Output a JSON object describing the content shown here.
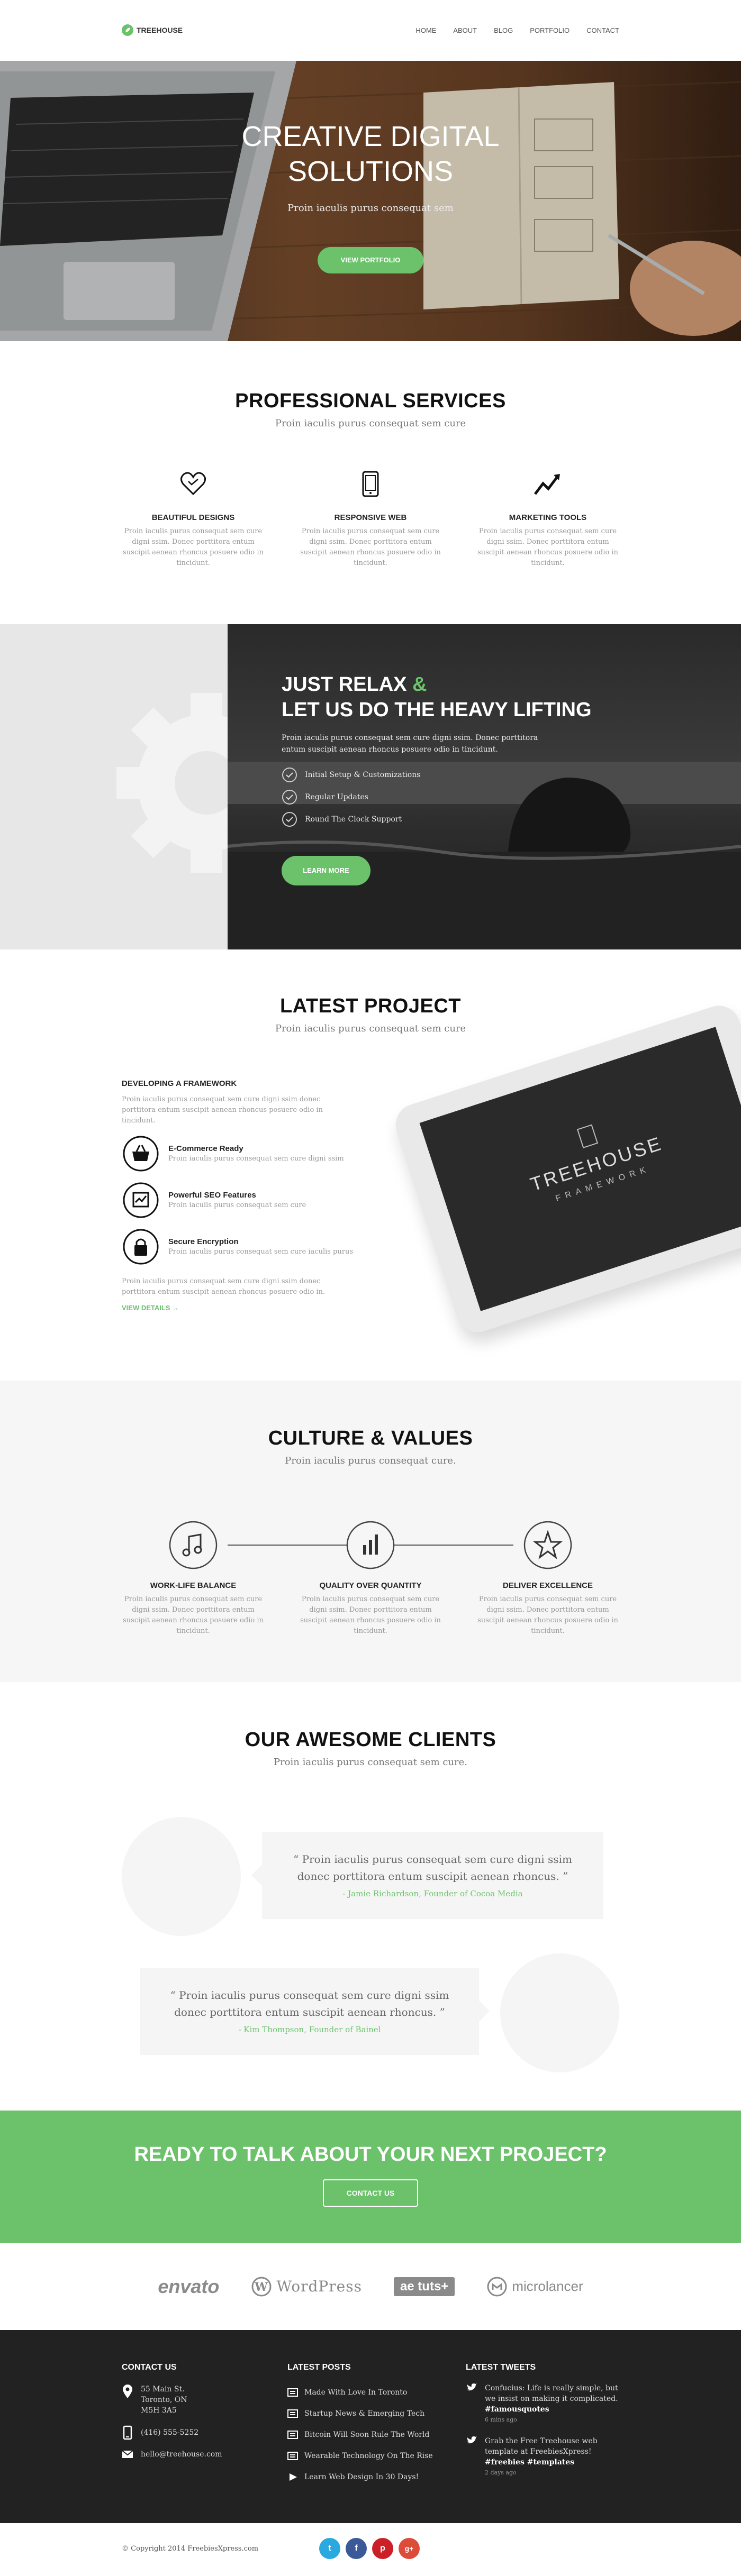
{
  "nav": {
    "brand": "TREEHOUSE",
    "items": [
      "HOME",
      "ABOUT",
      "BLOG",
      "PORTFOLIO",
      "CONTACT"
    ]
  },
  "hero": {
    "title_line1": "CREATIVE DIGITAL",
    "title_line2": "SOLUTIONS",
    "subtitle": "Proin iaculis purus consequat sem",
    "button": "VIEW PORTFOLIO"
  },
  "services": {
    "title": "PROFESSIONAL SERVICES",
    "subtitle": "Proin iaculis purus consequat sem cure",
    "items": [
      {
        "icon": "heart-icon",
        "title": "BEAUTIFUL DESIGNS",
        "text": "Proin iaculis purus consequat sem cure digni ssim. Donec porttitora entum suscipit aenean rhoncus posuere odio in tincidunt."
      },
      {
        "icon": "tablet-icon",
        "title": "RESPONSIVE WEB",
        "text": "Proin iaculis purus consequat sem cure digni ssim. Donec porttitora entum suscipit aenean rhoncus posuere odio in tincidunt."
      },
      {
        "icon": "chart-icon",
        "title": "MARKETING TOOLS",
        "text": "Proin iaculis purus consequat sem cure digni ssim. Donec porttitora entum suscipit aenean rhoncus posuere odio in tincidunt."
      }
    ]
  },
  "relax": {
    "title_a": "JUST RELAX ",
    "title_amp": "&",
    "title_b": "LET US DO THE HEAVY LIFTING",
    "text": "Proin iaculis purus consequat sem cure  digni ssim. Donec porttitora entum suscipit  aenean rhoncus posuere odio in tincidunt.",
    "list": [
      "Initial Setup & Customizations",
      "Regular Updates",
      "Round The Clock Support"
    ],
    "button": "LEARN MORE"
  },
  "project": {
    "title": "LATEST PROJECT",
    "subtitle": "Proin iaculis purus consequat sem cure",
    "heading": "DEVELOPING A FRAMEWORK",
    "intro": "Proin iaculis purus consequat sem cure  digni ssim donec porttitora entum suscipit  aenean rhoncus posuere odio in tincidunt.",
    "features": [
      {
        "icon": "basket-icon",
        "title": "E-Commerce Ready",
        "text": "Proin iaculis purus consequat sem cure  digni ssim"
      },
      {
        "icon": "seo-chart-icon",
        "title": "Powerful SEO Features",
        "text": "Proin iaculis purus consequat sem cure"
      },
      {
        "icon": "lock-icon",
        "title": "Secure Encryption",
        "text": "Proin iaculis purus consequat sem cure iaculis purus"
      }
    ],
    "outro": "Proin iaculis purus consequat sem cure  digni ssim donec porttitora entum suscipit  aenean rhoncus posuere odio in.",
    "link": "VIEW DETAILS →",
    "tablet_brand": "TREEHOUSE",
    "tablet_sub": "FRAMEWORK"
  },
  "culture": {
    "title": "CULTURE & VALUES",
    "subtitle": "Proin iaculis purus consequat cure.",
    "items": [
      {
        "icon": "music-icon",
        "title": "WORK-LIFE BALANCE",
        "text": "Proin iaculis purus consequat sem cure digni ssim. Donec porttitora entum suscipit aenean rhoncus posuere odio in tincidunt."
      },
      {
        "icon": "bars-icon",
        "title": "QUALITY OVER QUANTITY",
        "text": "Proin iaculis purus consequat sem cure digni ssim. Donec porttitora entum suscipit aenean rhoncus posuere odio in tincidunt."
      },
      {
        "icon": "star-icon",
        "title": "DELIVER EXCELLENCE",
        "text": "Proin iaculis purus consequat sem cure digni ssim. Donec porttitora entum suscipit aenean rhoncus posuere odio in tincidunt."
      }
    ]
  },
  "clients": {
    "title": "OUR AWESOME CLIENTS",
    "subtitle": "Proin iaculis purus consequat sem cure.",
    "testimonials": [
      {
        "quote": "“ Proin iaculis purus consequat sem cure  digni ssim donec porttitora entum suscipit aenean rhoncus. ”",
        "author": "- Jamie Richardson, Founder of Cocoa Media"
      },
      {
        "quote": "“ Proin iaculis purus consequat sem cure  digni ssim donec porttitora entum suscipit aenean rhoncus. ”",
        "author": "- Kim Thompson, Founder of Bainel"
      }
    ]
  },
  "cta": {
    "title": "READY TO TALK ABOUT YOUR NEXT PROJECT?",
    "button": "CONTACT US"
  },
  "logos": [
    "envato",
    "WordPress",
    "ae tuts+",
    "microlancer"
  ],
  "footer": {
    "contact_title": "CONTACT US",
    "address": [
      "55 Main St.",
      "Toronto, ON",
      "M5H 3A5"
    ],
    "phone": "(416) 555-5252",
    "email": "hello@treehouse.com",
    "posts_title": "LATEST POSTS",
    "posts": [
      "Made With Love In Toronto",
      "Startup News & Emerging Tech",
      "Bitcoin Will Soon Rule The World",
      "Wearable Technology On The Rise",
      "Learn Web Design In 30 Days!"
    ],
    "tweets_title": "LATEST TWEETS",
    "tweets": [
      {
        "text": "Confucius: Life is really simple, but we insist on making it complicated.",
        "tag": "#famousquotes",
        "time": "6 mins ago"
      },
      {
        "text": "Grab the Free Treehouse web template at FreebiesXpress!",
        "tag": "#freebies #templates",
        "time": "2 days ago"
      }
    ],
    "copyright": "© Copyright 2014 FreebiesXpress.com",
    "social": [
      "t",
      "f",
      "p",
      "g+"
    ]
  },
  "colors": {
    "accent": "#6bc26b",
    "dark": "#222222",
    "social": [
      "#2aa9e0",
      "#3b5998",
      "#cb2027",
      "#dd4b39"
    ]
  }
}
